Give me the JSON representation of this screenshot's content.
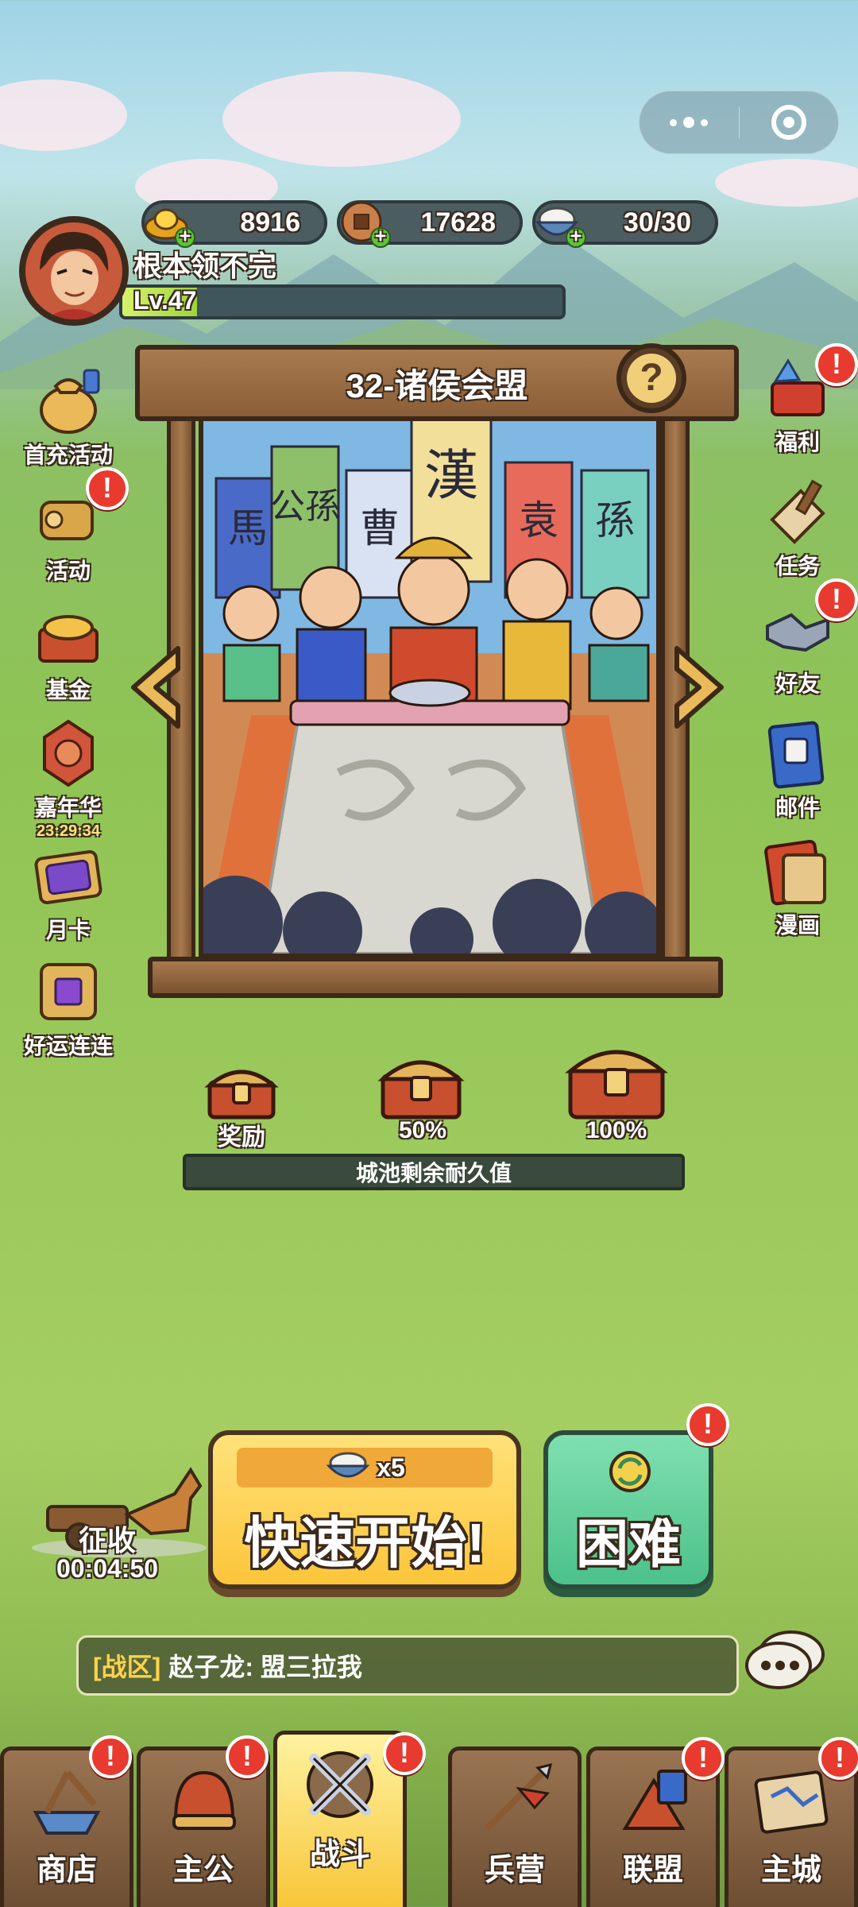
{
  "top_capsule": {
    "more": "more-dots",
    "close": "target"
  },
  "resources": [
    {
      "name": "gold",
      "value": "8916"
    },
    {
      "name": "copper-coin",
      "value": "17628"
    },
    {
      "name": "rice",
      "value": "30/30"
    }
  ],
  "player": {
    "name": "根本领不完",
    "level": "Lv.47",
    "exp_progress": 0.17
  },
  "left_menu": [
    {
      "label": "首充活动",
      "badge": false
    },
    {
      "label": "活动",
      "badge": true
    },
    {
      "label": "基金",
      "badge": false
    },
    {
      "label": "嘉年华",
      "timer": "23:29:34",
      "badge": false
    },
    {
      "label": "月卡",
      "badge": false
    },
    {
      "label": "好运连连",
      "badge": false
    }
  ],
  "right_menu": [
    {
      "label": "福利",
      "badge": true
    },
    {
      "label": "任务",
      "badge": false
    },
    {
      "label": "好友",
      "badge": true
    },
    {
      "label": "邮件",
      "badge": false
    },
    {
      "label": "漫画",
      "badge": false
    }
  ],
  "stage": {
    "title": "32-诸侯会盟",
    "banners": [
      "馬",
      "公孫",
      "曹",
      "漢",
      "袁",
      "孫"
    ]
  },
  "rewards": [
    {
      "label": "奖励"
    },
    {
      "label": "50%"
    },
    {
      "label": "100%"
    }
  ],
  "durability": {
    "label": "城池剩余耐久值"
  },
  "collect": {
    "label": "征收",
    "timer": "00:04:50"
  },
  "quick_start": {
    "cost": "x5",
    "label": "快速开始!"
  },
  "hard": {
    "label": "困难"
  },
  "chat": {
    "channel": "[战区]",
    "message": "赵子龙: 盟三拉我"
  },
  "tabs": [
    {
      "label": "商店",
      "badge": true,
      "active": false
    },
    {
      "label": "主公",
      "badge": true,
      "active": false
    },
    {
      "label": "战斗",
      "badge": true,
      "active": true
    },
    {
      "label": "兵营",
      "badge": false,
      "active": false
    },
    {
      "label": "联盟",
      "badge": true,
      "active": false
    },
    {
      "label": "主城",
      "badge": true,
      "active": false
    }
  ],
  "colors": {
    "badge_red": "#e83a2e",
    "quick_yellow": "#fcc53a",
    "hard_green": "#4cc18a",
    "wood": "#8a5e38"
  }
}
